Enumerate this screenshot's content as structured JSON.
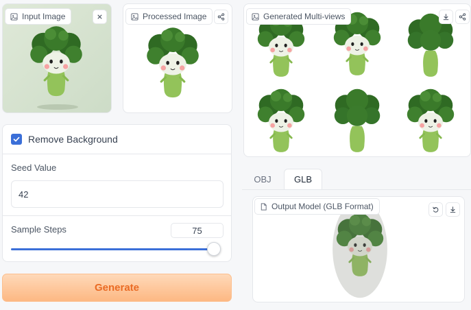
{
  "input_panel": {
    "label": "Input Image",
    "label_icon": "image-icon",
    "clear_icon": "close-icon"
  },
  "processed_panel": {
    "label": "Processed Image",
    "label_icon": "image-icon",
    "action_icons": [
      "download-icon",
      "share-icon"
    ]
  },
  "settings": {
    "remove_background": {
      "label": "Remove Background",
      "checked": true
    },
    "seed": {
      "label": "Seed Value",
      "value": "42"
    },
    "steps": {
      "label": "Sample Steps",
      "value": "75",
      "slider_fraction": 1.0
    }
  },
  "generate_button": {
    "label": "Generate"
  },
  "multiviews_panel": {
    "label": "Generated Multi-views",
    "label_icon": "image-icon",
    "action_icons": [
      "download-icon",
      "share-icon"
    ]
  },
  "output_tabs": [
    {
      "label": "OBJ",
      "active": false
    },
    {
      "label": "GLB",
      "active": true
    }
  ],
  "output_panel": {
    "label": "Output Model (GLB Format)",
    "label_icon": "file-icon",
    "action_icons": [
      "undo-icon",
      "download-icon"
    ]
  },
  "colors": {
    "accent_blue": "#3b6fd8",
    "generate_text": "#ea6b24",
    "broccoli_dark": "#3f7a2c",
    "stem_green": "#95c45b"
  }
}
